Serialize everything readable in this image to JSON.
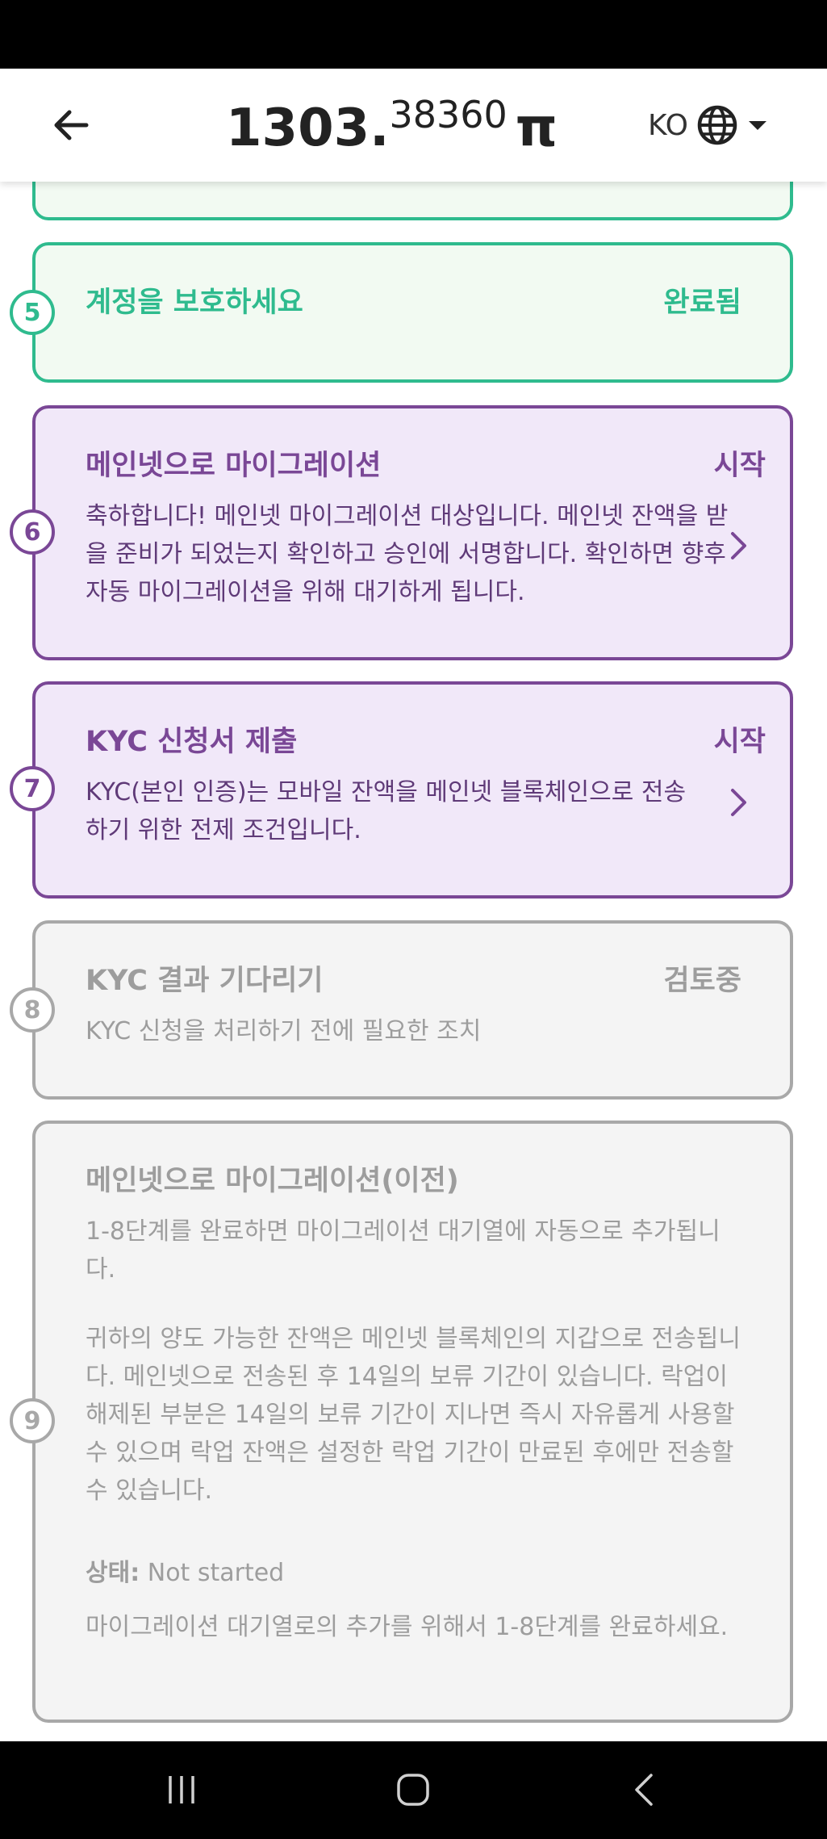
{
  "header": {
    "balance_integer": "1303.",
    "balance_decimal": "38360",
    "currency_symbol": "π",
    "language_code": "KO"
  },
  "steps": [
    {
      "number": "5",
      "title": "계정을 보호하세요",
      "status": "완료됨",
      "state": "completed"
    },
    {
      "number": "6",
      "title": "메인넷으로 마이그레이션",
      "status": "시작",
      "state": "active",
      "description": "축하합니다! 메인넷 마이그레이션 대상입니다. 메인넷 잔액을 받을 준비가 되었는지 확인하고 승인에 서명합니다. 확인하면 향후 자동 마이그레이션을 위해 대기하게 됩니다."
    },
    {
      "number": "7",
      "title": "KYC 신청서 제출",
      "status": "시작",
      "state": "active",
      "description": "KYC(본인 인증)는 모바일 잔액을 메인넷 블록체인으로 전송하기 위한 전제 조건입니다."
    },
    {
      "number": "8",
      "title": "KYC 결과 기다리기",
      "status": "검토중",
      "state": "pending",
      "description": "KYC 신청을 처리하기 전에 필요한 조치"
    },
    {
      "number": "9",
      "title": "메인넷으로 마이그레이션(이전)",
      "status": "",
      "state": "pending",
      "paragraph1": "1-8단계를 완료하면 마이그레이션 대기열에 자동으로 추가됩니다.",
      "paragraph2": "귀하의 양도 가능한 잔액은 메인넷 블록체인의 지갑으로 전송됩니다. 메인넷으로 전송된 후 14일의 보류 기간이 있습니다. 락업이 해제된 부분은 14일의 보류 기간이 지나면 즉시 자유롭게 사용할 수 있으며 락업 잔액은 설정한 락업 기간이 만료된 후에만 전송할 수 있습니다.",
      "status_label": "상태:",
      "status_value": "Not started",
      "note": "마이그레이션 대기열로의 추가를 위해서 1-8단계를 완료하세요."
    }
  ],
  "colors": {
    "green": "#2fbb8e",
    "purple": "#7a4796",
    "gray": "#a8a8a8"
  },
  "icons": {
    "back": "arrow-left-icon",
    "globe": "globe-icon",
    "dropdown": "caret-down-icon",
    "chevron": "chevron-right-icon"
  }
}
